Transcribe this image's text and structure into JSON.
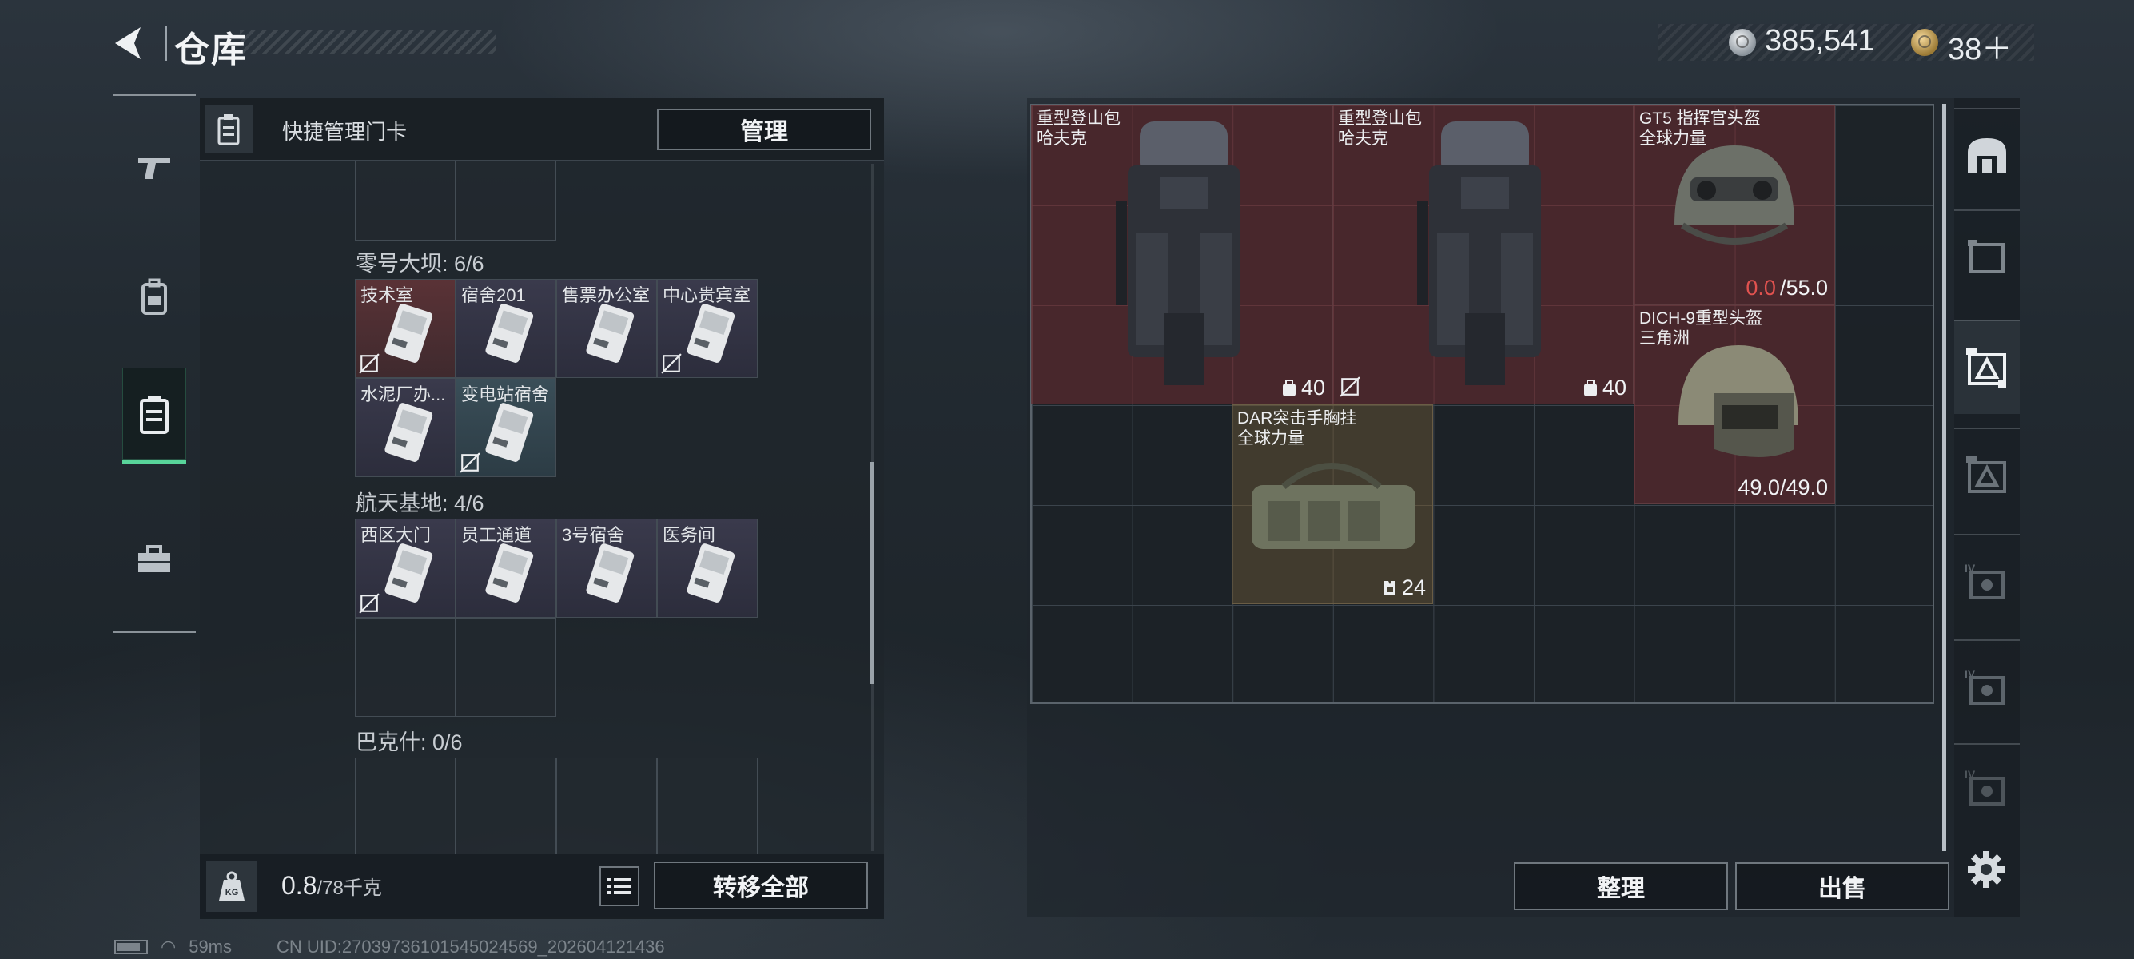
{
  "header": {
    "title": "仓库",
    "silver_currency": "385,541",
    "gold_currency": "38＋"
  },
  "keycard_panel": {
    "label": "快捷管理门卡",
    "manage_button": "管理"
  },
  "sections": [
    {
      "title": "零号大坝: 6/6",
      "cards": [
        {
          "name": "技术室",
          "color": "#5a3236",
          "no_transfer": true
        },
        {
          "name": "宿舍201",
          "color": "#3a3a4c",
          "no_transfer": false
        },
        {
          "name": "售票办公室",
          "color": "#3a3a4c",
          "no_transfer": false
        },
        {
          "name": "中心贵宾室",
          "color": "#3a3a4c",
          "no_transfer": true
        },
        {
          "name": "水泥厂办...",
          "color": "#3a3a4c",
          "no_transfer": false
        },
        {
          "name": "变电站宿舍",
          "color": "#3a4e58",
          "no_transfer": true
        }
      ]
    },
    {
      "title": "航天基地: 4/6",
      "cards": [
        {
          "name": "西区大门",
          "color": "#3a3a4c",
          "no_transfer": true
        },
        {
          "name": "员工通道",
          "color": "#3a3a4c",
          "no_transfer": false
        },
        {
          "name": "3号宿舍",
          "color": "#3a3a4c",
          "no_transfer": false
        },
        {
          "name": "医务间",
          "color": "#3a3a4c",
          "no_transfer": false
        }
      ]
    },
    {
      "title": "巴克什: 0/6",
      "cards": []
    }
  ],
  "weight": {
    "current": "0.8",
    "max": "/78千克"
  },
  "buttons": {
    "transfer_all": "转移全部",
    "sort": "整理",
    "sell": "出售"
  },
  "stash_items": [
    {
      "name_line1": "重型登山包",
      "name_line2": "哈夫克",
      "stat": "40",
      "stat_red": "",
      "kind": "backpack"
    },
    {
      "name_line1": "重型登山包",
      "name_line2": "哈夫克",
      "stat": "40",
      "stat_red": "",
      "kind": "backpack"
    },
    {
      "name_line1": "GT5 指挥官头盔",
      "name_line2": "全球力量",
      "stat": "/55.0",
      "stat_red": "0.0",
      "kind": "helmet"
    },
    {
      "name_line1": "DICH-9重型头盔",
      "name_line2": "三角洲",
      "stat": "49.0/49.0",
      "stat_red": "",
      "kind": "helmet"
    },
    {
      "name_line1": "DAR突击手胸挂",
      "name_line2": "全球力量",
      "stat": "24",
      "stat_red": "",
      "kind": "chest-rig"
    }
  ],
  "status": {
    "ping": "59ms",
    "uid": "CN UID:2703973610154502​4569_202604121436"
  },
  "icons": [
    "back-arrow-icon",
    "silver-coin-icon",
    "gold-coin-icon",
    "gun-icon",
    "backpack-icon",
    "keycard-case-icon",
    "toolbox-icon",
    "kg-weight-icon",
    "list-icon",
    "settings-gear-icon"
  ]
}
